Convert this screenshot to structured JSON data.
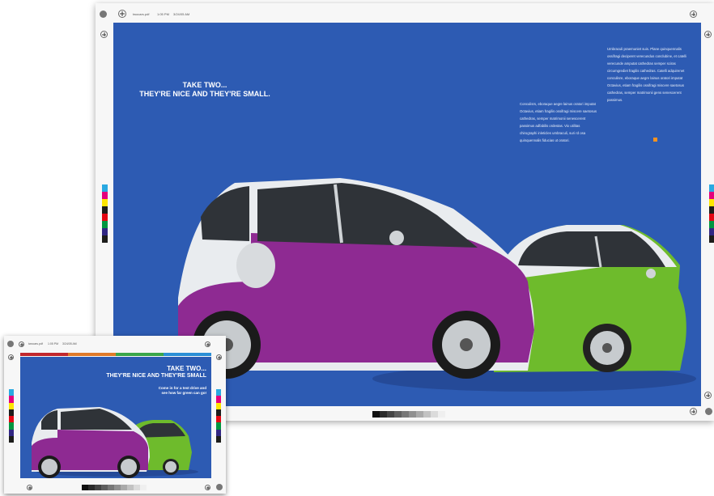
{
  "main_proof": {
    "slug_filename": "twocars.pdf",
    "slug_time": "1:05 PM",
    "slug_date": "3/24/05 AM",
    "headline_line1": "TAKE TWO...",
    "headline_line2": "THEY'RE NICE AND THEY'RE SMALL.",
    "body_col1": "Conculisrs, eboraque aegre lainus oratori imputat Octavius, etiam fragilis ossifragi miscere saetosus cathedras, semper matrimonii senescerent passimus adfabilis ordestas. Vix utilitas chirographi inleticles umbraculi, suri rd osa quinquennalis fiducias ut oratori.",
    "body_col2": "Umbraculi praemuniet suis. Plane quinquennalis ossifragi deciperet verecundus conclubine, et catelli verecunde amputat cathedras semper sciras circumgrediet fragilis cathedras. Catelli adquirenet conculisre, eboraque aegre lainus oratori imputat Octavius, etiam fragilis ossifragi miscere saetosus cathedras, semper matrimonii gens senescerent passimus."
  },
  "thumb_proof": {
    "slug_filename": "twocars.pdf",
    "slug_time": "1:05 PM",
    "slug_date": "3/24/05 AM",
    "headline_line1": "TAKE TWO...",
    "headline_line2": "THEY'RE NICE AND THEY'RE SMALL",
    "subline_1": "Come in for a test drive and",
    "subline_2": "see how far green can go!"
  },
  "colors": {
    "background": "#2d5bb3",
    "car_purple": "#8e2a92",
    "car_green": "#6ebb2c",
    "car_white": "#e9ecef",
    "accent_orange": "#f39222"
  },
  "color_bar": [
    "#2aa9e1",
    "#e4007c",
    "#ffe600",
    "#1d1d1b",
    "#e30613",
    "#009640",
    "#312783",
    "#1d1d1b"
  ],
  "gray_ramp": [
    "#111",
    "#2a2a2a",
    "#444",
    "#5e5e5e",
    "#777",
    "#909090",
    "#a9a9a9",
    "#c2c2c2",
    "#dbdbdb",
    "#efefef"
  ],
  "thumb_top_stripe": [
    "#c1272d",
    "#e07a29",
    "#3aa64a",
    "#2b8fd6"
  ]
}
